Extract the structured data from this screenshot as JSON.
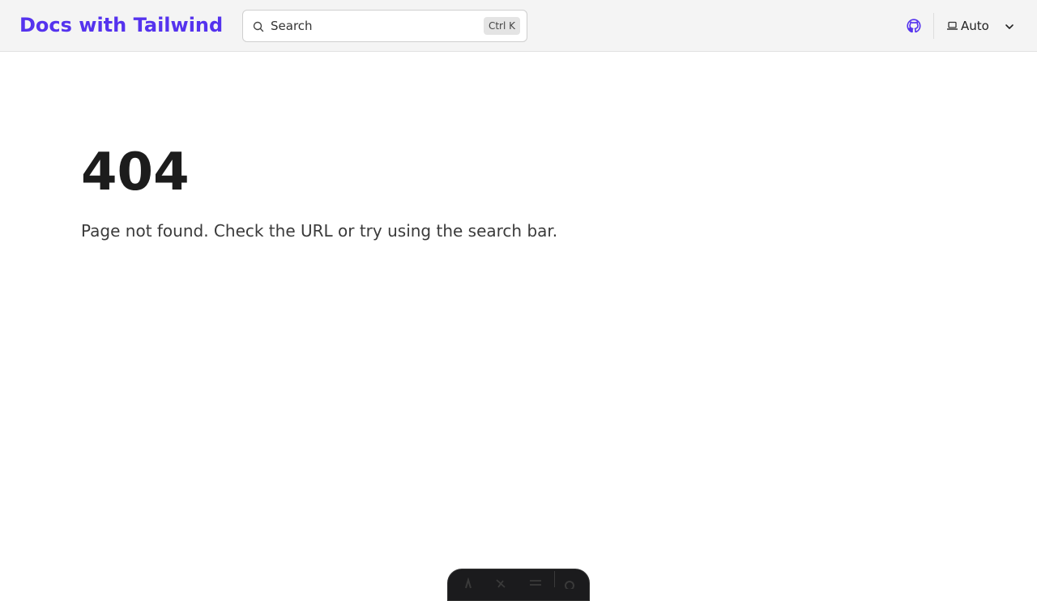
{
  "header": {
    "brand": "Docs with Tailwind",
    "search": {
      "placeholder": "Search",
      "shortcut": "Ctrl K"
    },
    "github_icon": "github-icon",
    "theme_selector": {
      "icon": "laptop-icon",
      "value": "Auto",
      "toggle_icon": "chevron-down-icon"
    }
  },
  "main": {
    "code": "404",
    "message": "Page not found. Check the URL or try using the search bar."
  },
  "dev_toolbar": {
    "icons": [
      "astro-icon",
      "audit-icon",
      "menu-icon",
      "settings-icon"
    ]
  },
  "colors": {
    "brand": "#5533ee",
    "header_bg": "#f4f4f4",
    "text": "#1c1c1c"
  }
}
